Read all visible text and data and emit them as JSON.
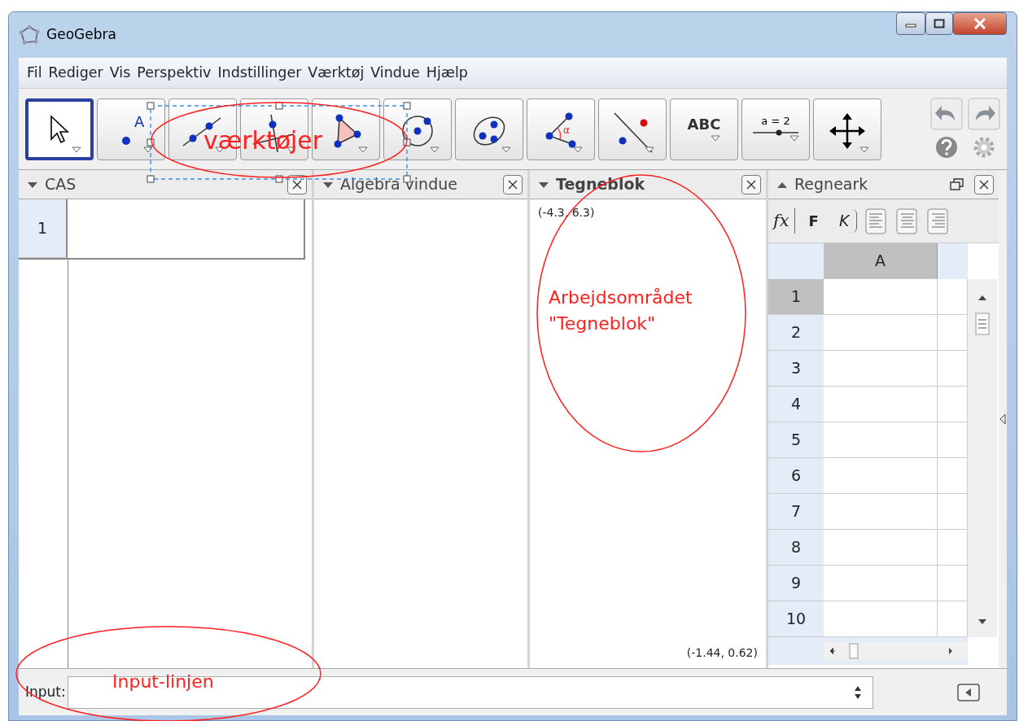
{
  "window": {
    "title": "GeoGebra"
  },
  "menu": [
    {
      "label": "Fil"
    },
    {
      "label": "Rediger"
    },
    {
      "label": "Vis"
    },
    {
      "label": "Perspektiv"
    },
    {
      "label": "Indstillinger"
    },
    {
      "label": "Værktøj"
    },
    {
      "label": "Vindue"
    },
    {
      "label": "Hjælp"
    }
  ],
  "toolbar": {
    "tools": [
      {
        "kind": "move",
        "selected": true
      },
      {
        "kind": "point",
        "glyph": "A",
        "selected": false
      },
      {
        "kind": "line",
        "selected": false
      },
      {
        "kind": "perpendicular",
        "selected": false
      },
      {
        "kind": "polygon",
        "selected": false
      },
      {
        "kind": "circle",
        "selected": false
      },
      {
        "kind": "conic",
        "selected": false
      },
      {
        "kind": "angle",
        "glyph": "α",
        "selected": false
      },
      {
        "kind": "reflect",
        "selected": false
      },
      {
        "kind": "text",
        "label": "ABC",
        "selected": false
      },
      {
        "kind": "slider",
        "label": "a = 2",
        "selected": false
      },
      {
        "kind": "move_view",
        "selected": false
      }
    ]
  },
  "cas": {
    "title": "CAS",
    "rows": [
      "1"
    ]
  },
  "algebra": {
    "title": "Algebra vindue"
  },
  "graphics": {
    "title": "Tegneblok",
    "top_left_coords": "(-4.3, 6.3)",
    "bottom_right_coords": "(-1.44, 0.62)"
  },
  "spreadsheet": {
    "title": "Regneark",
    "formula_label": "fx",
    "bold_button": "F",
    "italic_button": "K",
    "columns": [
      "A"
    ],
    "rows": [
      "1",
      "2",
      "3",
      "4",
      "5",
      "6",
      "7",
      "8",
      "9",
      "10"
    ]
  },
  "input_bar": {
    "label": "Input:"
  },
  "annotations": [
    {
      "kind": "toolbar",
      "lines": [
        "værktøjer"
      ]
    },
    {
      "kind": "graphics",
      "lines": [
        "Arbejdsområdet",
        "\"Tegneblok\""
      ]
    },
    {
      "kind": "input",
      "lines": [
        "Input-linjen"
      ]
    }
  ]
}
